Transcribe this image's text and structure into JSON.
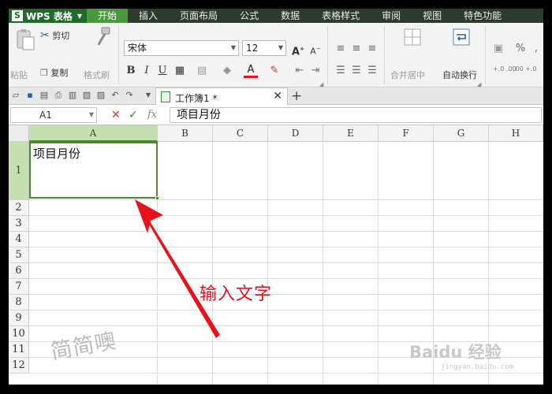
{
  "app": {
    "title": "WPS 表格"
  },
  "menu": [
    "开始",
    "插入",
    "页面布局",
    "公式",
    "数据",
    "表格样式",
    "审阅",
    "视图",
    "特色功能"
  ],
  "active_menu": "开始",
  "clipboard": {
    "paste": "粘贴",
    "cut": "剪切",
    "copy": "复制",
    "format_painter": "格式刷"
  },
  "font": {
    "name": "宋体",
    "size": "12"
  },
  "font_style": {
    "bold": "B",
    "italic": "I",
    "underline": "U",
    "font_color": "A"
  },
  "merge": {
    "label": "合并居中"
  },
  "wrap": {
    "label": "自动换行"
  },
  "number": {
    "percent": "%",
    "comma": ",",
    "inc_decimals": "+.0 .00",
    "dec_decimals": ".00 +.0"
  },
  "document_tab": {
    "name": "工作簿1 *"
  },
  "formula_bar": {
    "name_box": "A1",
    "fx": "fx",
    "value": "项目月份"
  },
  "grid": {
    "columns": [
      "A",
      "B",
      "C",
      "D",
      "E",
      "F",
      "G",
      "H"
    ],
    "selected_column": "A",
    "rows": [
      "1",
      "2",
      "3",
      "4",
      "5",
      "6",
      "7",
      "8",
      "9",
      "10",
      "11",
      "12"
    ],
    "selected_row": "1",
    "cell_a1": "项目月份"
  },
  "annotation": {
    "text": "输入文字",
    "color": "#e8111c"
  },
  "watermark": {
    "left": "简简噢",
    "brand": "Baidu 经验",
    "url": "jingyan.baidu.com"
  },
  "colors": {
    "menu_bg": "#2d3a2e",
    "accent": "#4a9a3d",
    "selection": "#4a8a2a"
  }
}
